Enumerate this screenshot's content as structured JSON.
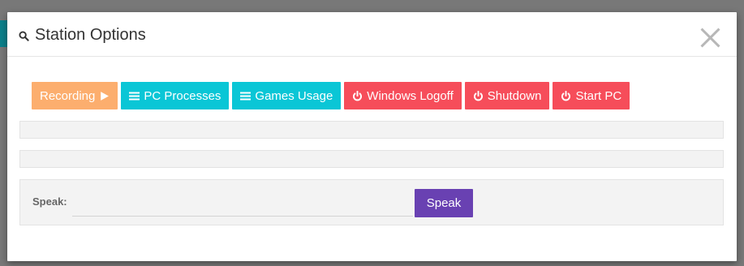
{
  "modal": {
    "title": "Station Options",
    "title_icon": "search-icon",
    "close_icon": "close-icon"
  },
  "buttons": [
    {
      "label": "Recording",
      "icon": "play-icon",
      "color": "#fcae6e"
    },
    {
      "label": "PC Processes",
      "icon": "list-icon",
      "color": "#0ac6d6"
    },
    {
      "label": "Games Usage",
      "icon": "list-icon",
      "color": "#0ac6d6"
    },
    {
      "label": "Windows Logoff",
      "icon": "power-icon",
      "color": "#f64d5a"
    },
    {
      "label": "Shutdown",
      "icon": "power-icon",
      "color": "#f64d5a"
    },
    {
      "label": "Start PC",
      "icon": "power-icon",
      "color": "#f64d5a"
    }
  ],
  "speak": {
    "label": "Speak:",
    "input_value": "",
    "button_label": "Speak",
    "button_color": "#6941b2"
  }
}
